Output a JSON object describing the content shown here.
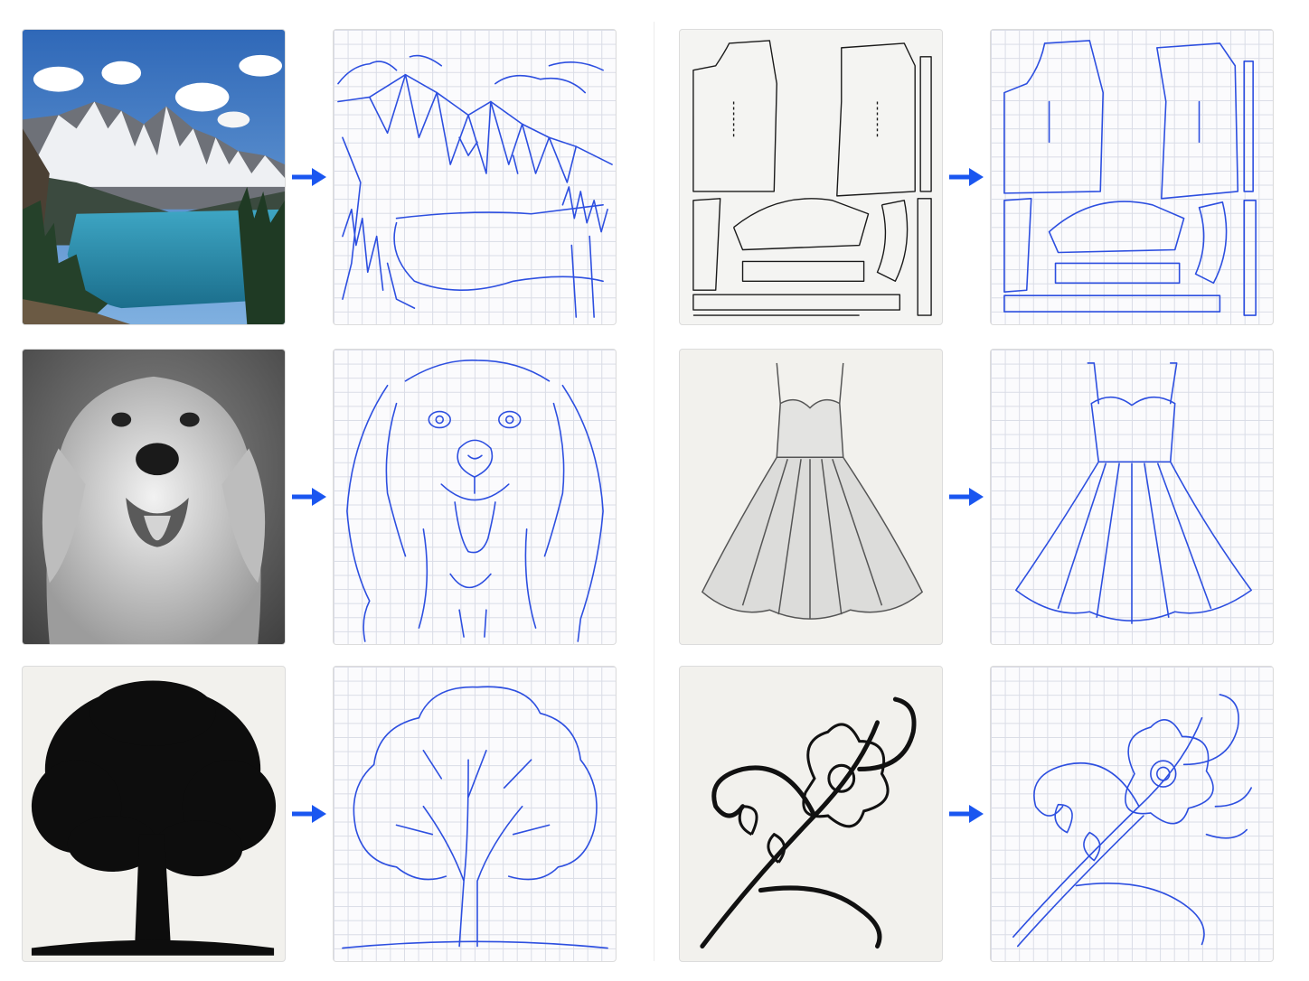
{
  "accent_color": "#1a56f0",
  "line_color": "#2d4fe0",
  "arrow_icon": "right-arrow-icon",
  "rows": [
    {
      "left": {
        "source": "mountain-lake-photo",
        "result": "mountain-lake-line-tracing"
      },
      "right": {
        "source": "sewing-pattern-pieces",
        "result": "sewing-pattern-line-tracing"
      }
    },
    {
      "left": {
        "source": "golden-retriever-photo",
        "result": "golden-retriever-line-tracing"
      },
      "right": {
        "source": "dress-pencil-sketch",
        "result": "dress-line-tracing"
      }
    },
    {
      "left": {
        "source": "tree-silhouette",
        "result": "tree-line-tracing"
      },
      "right": {
        "source": "floral-ornament-ink",
        "result": "floral-ornament-line-tracing"
      }
    }
  ]
}
